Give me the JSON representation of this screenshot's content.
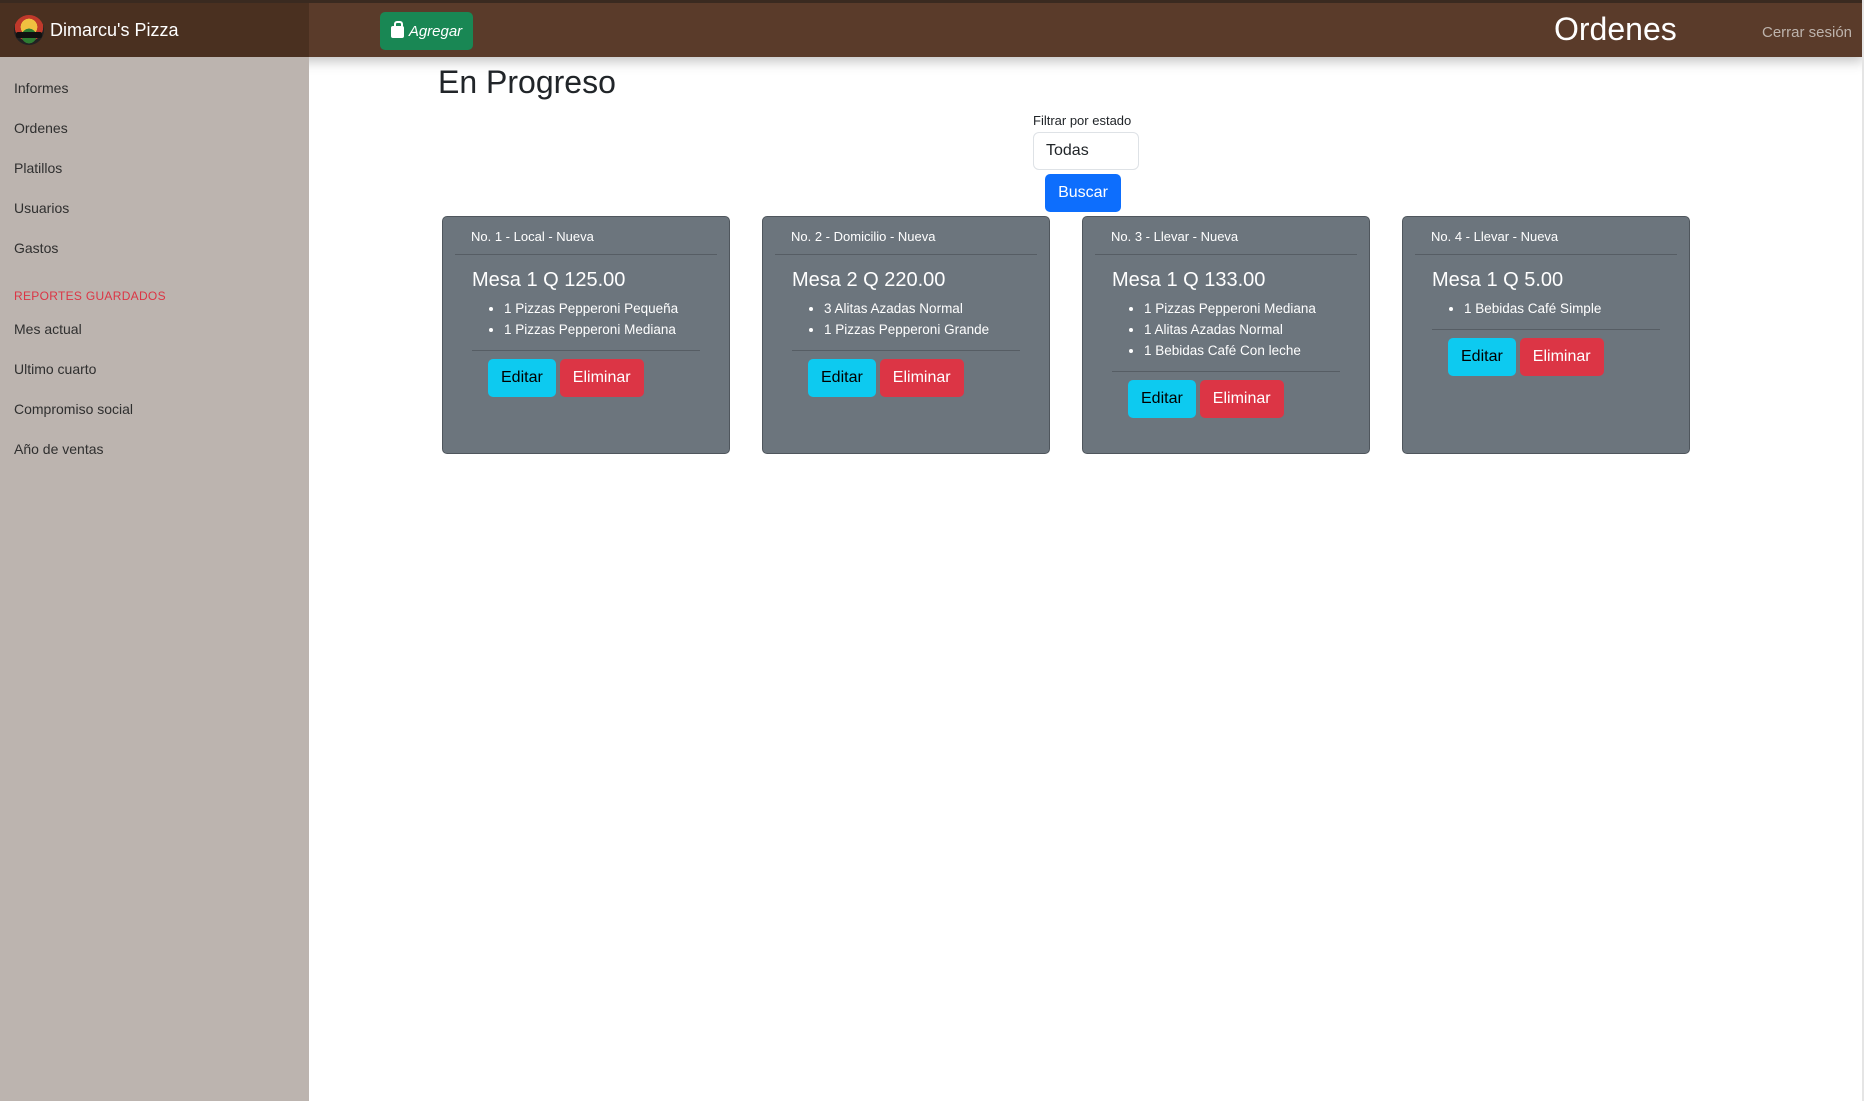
{
  "header": {
    "brand": "Dimarcu's Pizza",
    "add_label": "Agregar",
    "page_heading": "Ordenes",
    "logout_label": "Cerrar sesión"
  },
  "sidebar": {
    "items": [
      "Informes",
      "Ordenes",
      "Platillos",
      "Usuarios",
      "Gastos"
    ],
    "saved_heading": "REPORTES GUARDADOS",
    "saved_items": [
      "Mes actual",
      "Ultimo cuarto",
      "Compromiso social",
      "Año de ventas"
    ]
  },
  "main": {
    "section_title": "En Progreso",
    "filter_label": "Filtrar por estado",
    "filter_value": "Todas",
    "search_label": "Buscar",
    "edit_label": "Editar",
    "delete_label": "Eliminar",
    "orders": [
      {
        "header": "No. 1 - Local - Nueva",
        "title": "Mesa 1 Q 125.00",
        "items": [
          "1 Pizzas Pepperoni Pequeña",
          "1 Pizzas Pepperoni Mediana"
        ]
      },
      {
        "header": "No. 2 - Domicilio - Nueva",
        "title": "Mesa 2 Q 220.00",
        "items": [
          "3 Alitas Azadas Normal",
          "1 Pizzas Pepperoni Grande"
        ]
      },
      {
        "header": "No. 3 - Llevar - Nueva",
        "title": "Mesa 1 Q 133.00",
        "items": [
          "1 Pizzas Pepperoni Mediana",
          "1 Alitas Azadas Normal",
          "1 Bebidas Café Con leche"
        ]
      },
      {
        "header": "No. 4 - Llevar - Nueva",
        "title": "Mesa 1 Q 5.00",
        "items": [
          "1 Bebidas Café Simple"
        ]
      }
    ]
  }
}
